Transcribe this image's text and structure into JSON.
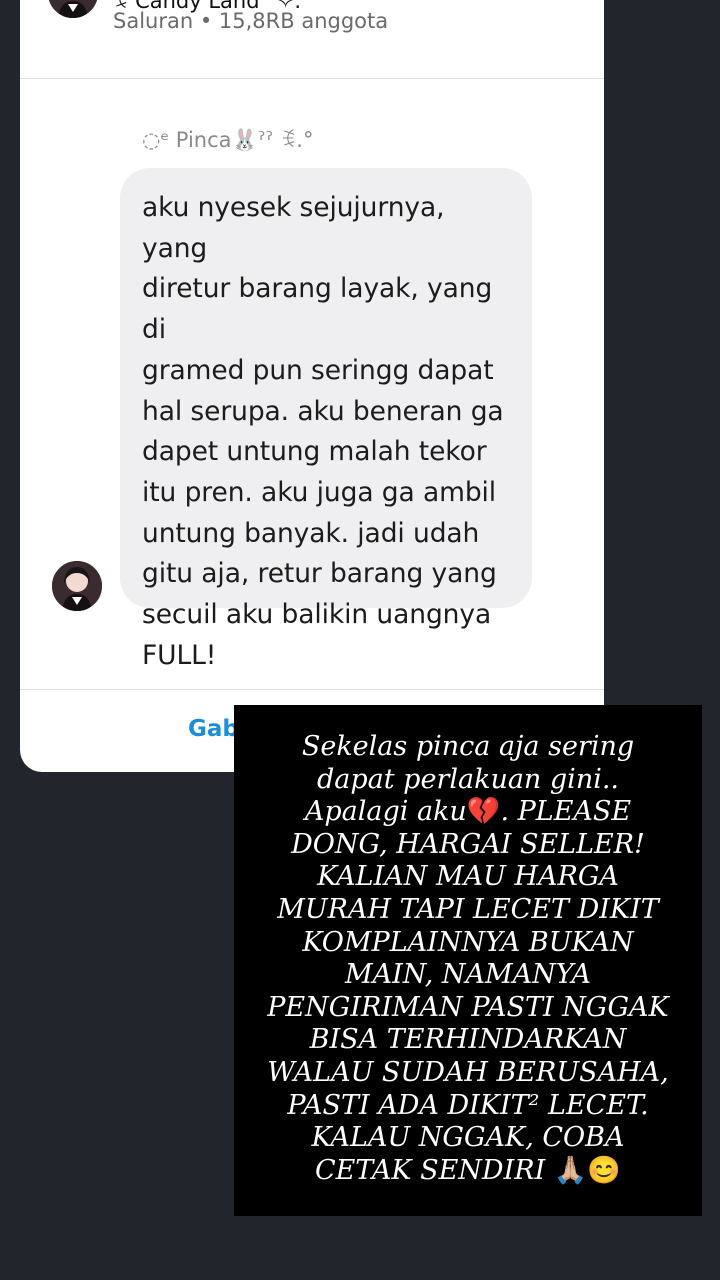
{
  "channel": {
    "name": "ꉂ Candy Land ˚✧.",
    "subtitle": "Saluran • 15,8RB anggota"
  },
  "message": {
    "sender": "◌ᵉ Pinca🐰ˀˀ ꉂ.°",
    "text": "aku nyesek sejujurnya, yang\ndiretur barang layak, yang di\ngramed pun seringg dapat\nhal serupa. aku beneran ga\ndapet untung malah tekor\nitu pren. aku juga ga ambil\nuntung banyak. jadi udah\ngitu aja, retur barang yang\nsecuil aku balikin uangnya\nFULL!"
  },
  "footer": {
    "join_label": "Gabung"
  },
  "overlay": {
    "text_before_heart": "Sekelas pinca aja sering\ndapat perlakuan gini..\nApalagi aku",
    "heart_emoji": "💔",
    "text_after_heart": ". PLEASE\nDONG, HARGAI SELLER!\nKALIAN MAU HARGA\nMURAH TAPI LECET DIKIT\nKOMPLAINNYA BUKAN\nMAIN, NAMANYA\nPENGIRIMAN PASTI NGGAK\nBISA TERHINDARKAN\nWALAU SUDAH  BERUSAHA,\nPASTI ADA DIKIT² LECET.\nKALAU NGGAK, COBA\nCETAK SENDIRI ",
    "end_emojis": "🙏🏼😊"
  },
  "colors": {
    "background": "#23252d",
    "card": "#ffffff",
    "bubble": "#efeff1",
    "accent": "#1a8fd6",
    "overlay": "#000000"
  }
}
